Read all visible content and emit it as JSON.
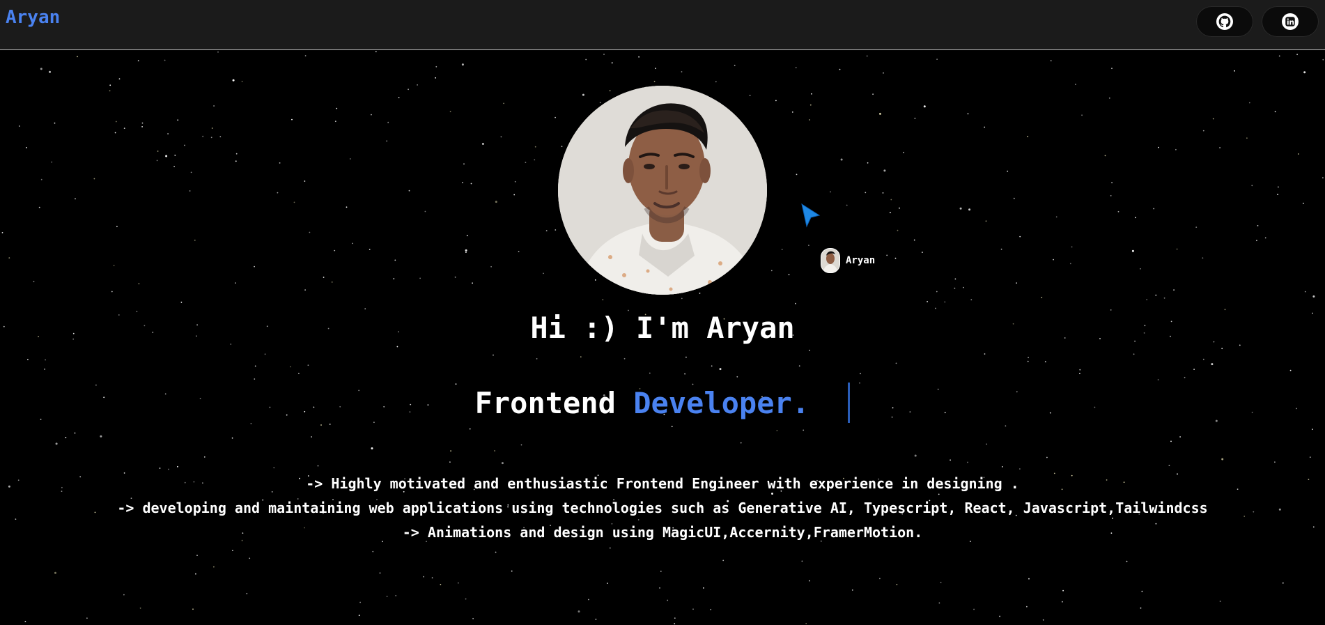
{
  "header": {
    "brand": "Aryan",
    "actions": [
      {
        "name": "github",
        "icon": "github-icon"
      },
      {
        "name": "linkedin",
        "icon": "linkedin-icon"
      }
    ]
  },
  "hero": {
    "avatar_icon": "profile-photo",
    "cursor_label": "Aryan",
    "greeting": "Hi :) I'm Aryan",
    "role_prefix": "Frontend",
    "role_highlight": "Developer.",
    "bio_lines": [
      "-> Highly motivated and enthusiastic Frontend Engineer with experience in designing .",
      "-> developing and maintaining web applications using technologies such as Generative AI, Typescript, React, Javascript,Tailwindcss",
      "-> Animations and design using MagicUI,Accernity,FramerMotion."
    ]
  },
  "colors": {
    "accent": "#4a82f0",
    "navbar_bg": "#1b1b1b",
    "page_bg": "#000000",
    "cursor": "#1e88e5"
  }
}
